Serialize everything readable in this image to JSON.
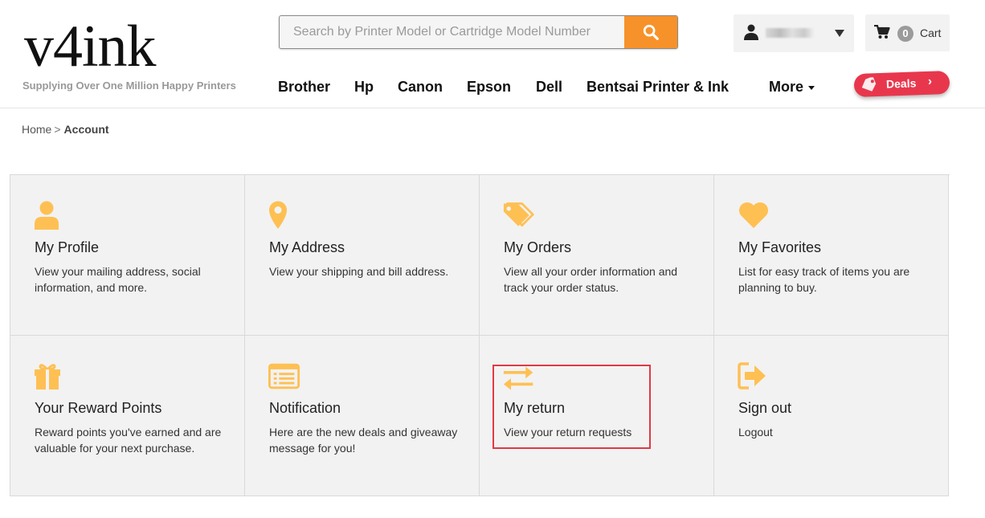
{
  "brand": {
    "logo": "v4ink",
    "tagline": "Supplying Over One Million Happy Printers"
  },
  "search": {
    "placeholder": "Search by Printer Model or Cartridge Model Number",
    "button_icon": "search-icon"
  },
  "user": {
    "name": "********",
    "icon": "user-icon",
    "dropdown_icon": "caret-down-icon"
  },
  "cart": {
    "count": "0",
    "label": "Cart",
    "icon": "cart-icon"
  },
  "nav": {
    "items": [
      "Brother",
      "Hp",
      "Canon",
      "Epson",
      "Dell",
      "Bentsai Printer & Ink"
    ],
    "more_label": "More"
  },
  "deals": {
    "label": "Deals",
    "chevron": "›"
  },
  "breadcrumb": {
    "home": "Home",
    "separator": ">",
    "current": "Account"
  },
  "colors": {
    "accent": "#f7922a",
    "icon": "#fec053",
    "deals": "#e8374d",
    "highlight": "#e03a44"
  },
  "cards": [
    {
      "title": "My Profile",
      "desc": "View your mailing address, social information, and more.",
      "icon": "user-icon"
    },
    {
      "title": "My Address",
      "desc": "View your shipping and bill address.",
      "icon": "map-pin-icon"
    },
    {
      "title": "My Orders",
      "desc": "View all your order information and track your order status.",
      "icon": "tags-icon"
    },
    {
      "title": "My Favorites",
      "desc": "List for easy track of items you are planning to buy.",
      "icon": "heart-icon"
    },
    {
      "title": "Your Reward Points",
      "desc": "Reward points you've earned and are valuable for your next purchase.",
      "icon": "gift-icon"
    },
    {
      "title": "Notification",
      "desc": "Here are the new deals and giveaway message for you!",
      "icon": "list-icon"
    },
    {
      "title": "My return",
      "desc": "View your return requests",
      "icon": "exchange-arrows-icon"
    },
    {
      "title": "Sign out",
      "desc": "Logout",
      "icon": "sign-out-icon"
    }
  ]
}
